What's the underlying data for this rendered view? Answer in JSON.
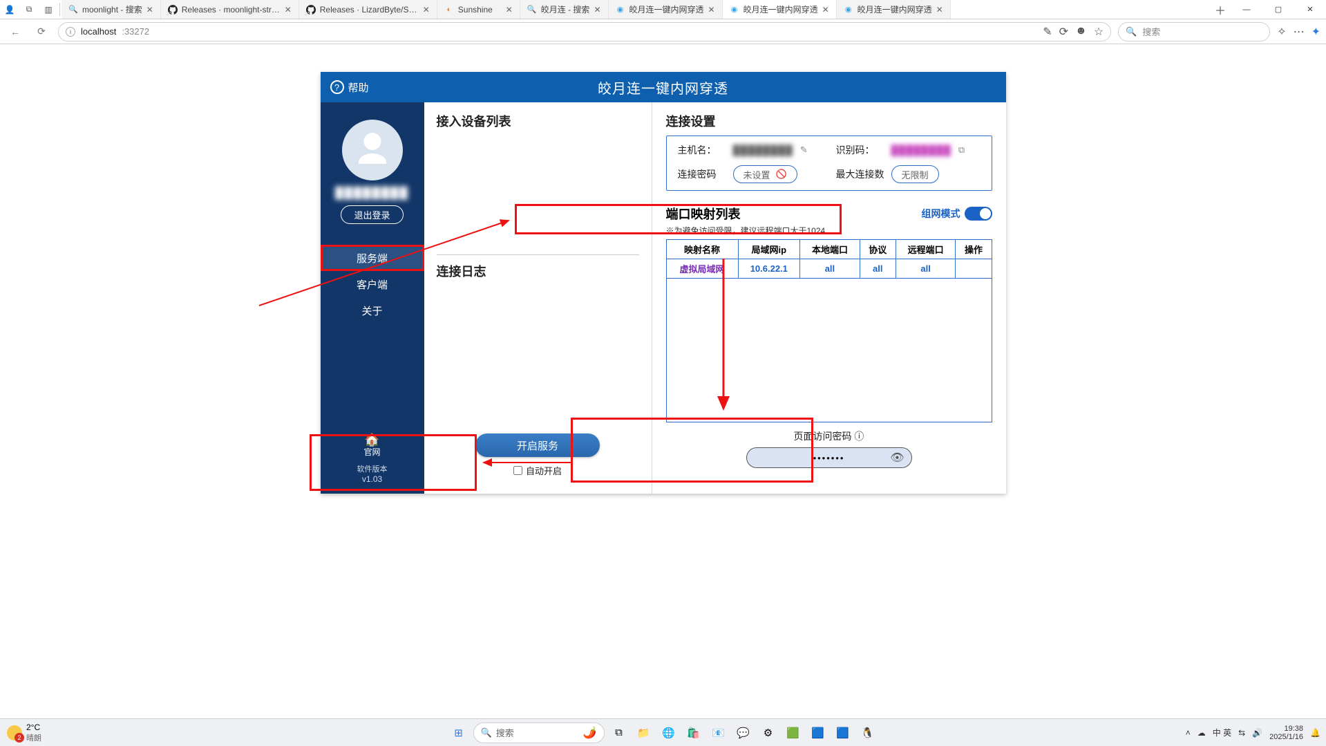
{
  "titlebar": {
    "tabs": [
      {
        "title": "moonlight - 搜索",
        "icon": "🔍",
        "iconColor": "#2b7de1",
        "active": false
      },
      {
        "title": "Releases · moonlight-stre…",
        "icon": "github",
        "active": false
      },
      {
        "title": "Releases · LizardByte/Sun…",
        "icon": "github",
        "active": false
      },
      {
        "title": "Sunshine",
        "icon": "◐",
        "iconColor": "#f08030",
        "active": false
      },
      {
        "title": "皎月连 - 搜索",
        "icon": "🔍",
        "iconColor": "#2b7de1",
        "active": false
      },
      {
        "title": "皎月连一键内网穿透",
        "icon": "◉",
        "iconColor": "#3aa5e6",
        "active": false
      },
      {
        "title": "皎月连一键内网穿透",
        "icon": "◉",
        "iconColor": "#3aa5e6",
        "active": true
      },
      {
        "title": "皎月连一键内网穿透",
        "icon": "◉",
        "iconColor": "#3aa5e6",
        "active": false
      }
    ]
  },
  "toolbar": {
    "url_host": "localhost",
    "url_port": ":33272",
    "search_placeholder": "搜索"
  },
  "app": {
    "help": "帮助",
    "title": "皎月连一键内网穿透",
    "sidebar": {
      "username": "████████",
      "logout": "退出登录",
      "items": [
        {
          "label": "服务端",
          "active": true,
          "highlight": true
        },
        {
          "label": "客户端",
          "active": false
        },
        {
          "label": "关于",
          "active": false
        }
      ],
      "home": "官网",
      "version_label": "软件版本",
      "version": "v1.03"
    },
    "left": {
      "devices_title": "接入设备列表",
      "log_title": "连接日志",
      "open_btn": "开启服务",
      "auto_open": "自动开启"
    },
    "right": {
      "conn_title": "连接设置",
      "host_label": "主机名：",
      "host_value": "████████",
      "id_label": "识别码：",
      "id_value": "████████",
      "pw_label": "连接密码",
      "pw_value": "未设置",
      "max_label": "最大连接数",
      "max_value": "无限制",
      "map_title": "端口映射列表",
      "netmode": "组网模式",
      "map_note": "※为避免访问受限，建议远程端口大于1024",
      "headers": [
        "映射名称",
        "局域网ip",
        "本地端口",
        "协议",
        "远程端口",
        "操作"
      ],
      "row": {
        "name": "虚拟局域网",
        "ip": "10.6.22.1",
        "lport": "all",
        "proto": "all",
        "rport": "all",
        "ops": ""
      },
      "page_pw_label": "页面访问密码 ⓘ",
      "page_pw_value": "•••••••"
    }
  },
  "taskbar": {
    "temp": "2°C",
    "cond": "晴朗",
    "search": "搜索",
    "ime": "中 英",
    "time": "19:38",
    "date": "2025/1/16"
  }
}
